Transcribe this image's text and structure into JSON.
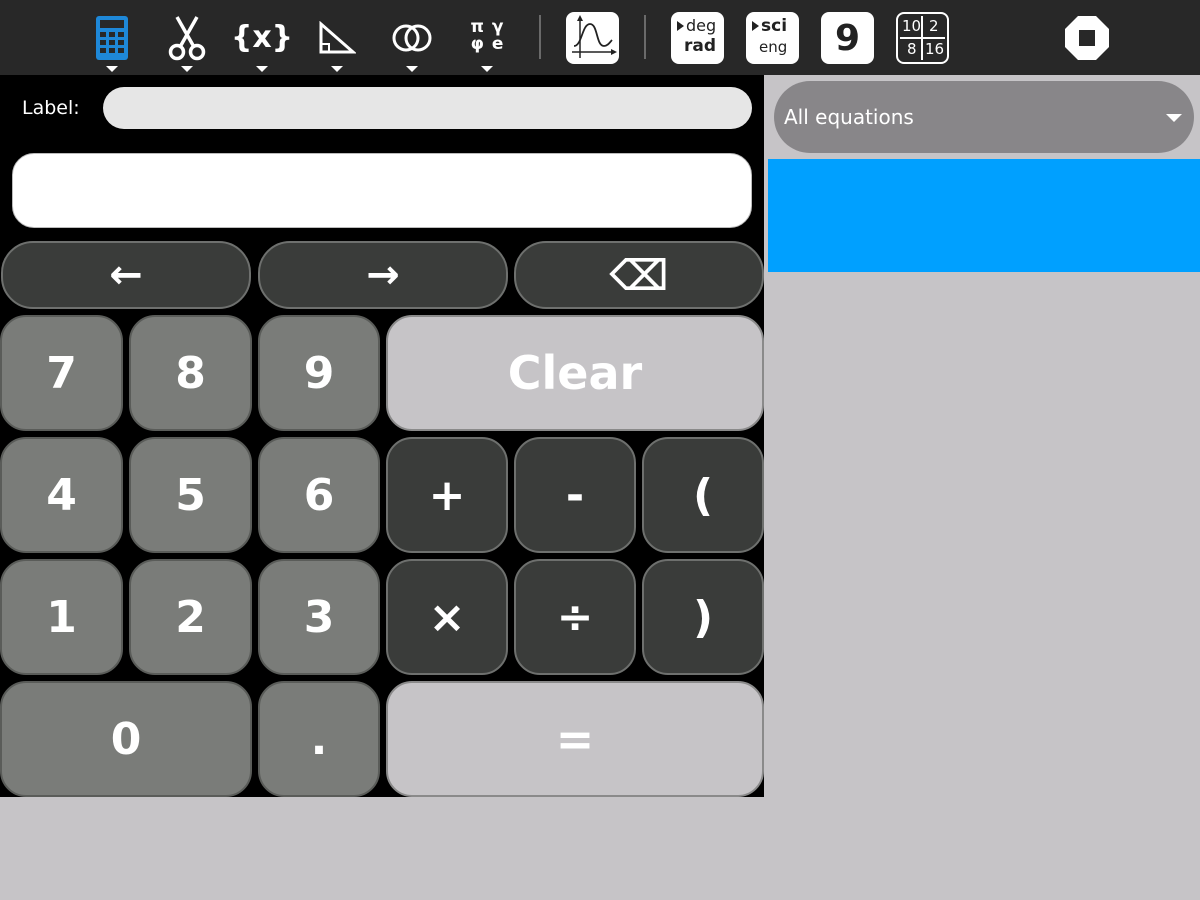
{
  "toolbar": {
    "variables_label": "{x}",
    "constants_label": "π γ φ e",
    "deg_label": "deg",
    "rad_label": "rad",
    "sci_label": "sci",
    "eng_label": "eng",
    "precision_label": "9",
    "base_labels": [
      "10",
      "2",
      "8",
      "16"
    ]
  },
  "form": {
    "label_caption": "Label:",
    "label_value": "",
    "expression_value": ""
  },
  "keypad": {
    "left": "←",
    "right": "→",
    "backspace": "⌫",
    "digits": [
      "7",
      "8",
      "9",
      "4",
      "5",
      "6",
      "1",
      "2",
      "3"
    ],
    "zero": "0",
    "dot": ".",
    "clear": "Clear",
    "plus": "+",
    "minus": "-",
    "open_paren": "(",
    "times": "×",
    "divide": "÷",
    "close_paren": ")",
    "equals": "="
  },
  "equations": {
    "filter_selected": "All equations"
  },
  "colors": {
    "toolbar_bg": "#282828",
    "accent": "#00a0ff",
    "panel_bg": "#c6c4c7"
  }
}
